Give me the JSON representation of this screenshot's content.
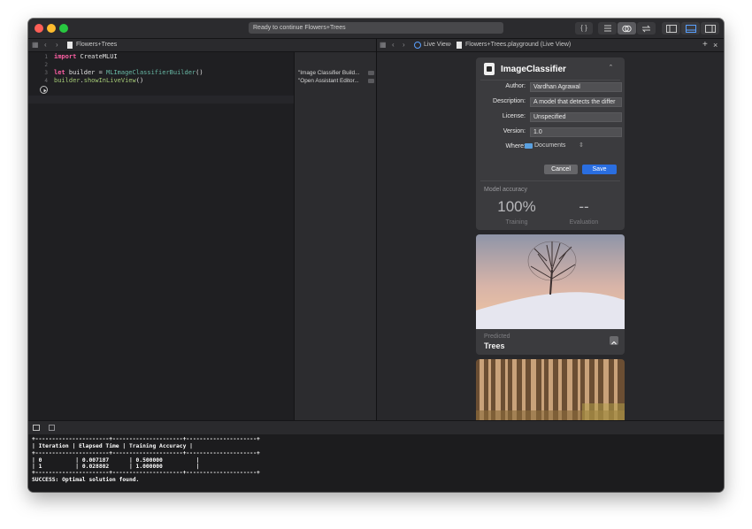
{
  "window": {
    "status_text": "Ready to continue Flowers+Trees",
    "toolbar_labels": {
      "braces": "{ }"
    }
  },
  "left_nav": {
    "file_name": "Flowers+Trees"
  },
  "right_nav": {
    "live_view": "Live View",
    "file_name": "Flowers+Trees.playground (Live View)"
  },
  "code": {
    "line_numbers": [
      "1",
      "2",
      "3",
      "4"
    ],
    "line1": {
      "kw": "import",
      "rest": " CreateMLUI"
    },
    "line3": {
      "kw": "let",
      "mid": " builder = ",
      "type": "MLImageClassifierBuilder",
      "end": "()"
    },
    "line4": {
      "obj": "builder",
      "dot": ".",
      "fn": "showInLiveView",
      "end": "()"
    }
  },
  "results": {
    "r1": "\"Image Classifier Build...",
    "r2": "\"Open Assistant Editor..."
  },
  "classifier": {
    "title": "ImageClassifier",
    "author_label": "Author:",
    "author_value": "Vardhan Agrawal",
    "description_label": "Description:",
    "description_value": "A model that detects the differ",
    "license_label": "License:",
    "license_value": "Unspecified",
    "version_label": "Version:",
    "version_value": "1.0",
    "where_label": "Where:",
    "where_value": "Documents",
    "cancel_label": "Cancel",
    "save_label": "Save",
    "accuracy_label": "Model accuracy",
    "training_value": "100%",
    "training_label": "Training",
    "evaluation_value": "--",
    "evaluation_label": "Evaluation"
  },
  "prediction": {
    "caption": "Predicted",
    "value": "Trees"
  },
  "console": {
    "sep": "+----------------------+---------------------+---------------------+",
    "header": "| Iteration | Elapsed Time | Training Accuracy |",
    "row1": "| 0          | 0.007187      | 0.500000          |",
    "row2": "| 1          | 0.028802      | 1.000000          |",
    "success": "SUCCESS: Optimal solution found."
  },
  "colors": {
    "accent": "#2a6ee0",
    "keyword": "#fc5fa3",
    "type": "#67b7a4",
    "function": "#a3c875"
  }
}
